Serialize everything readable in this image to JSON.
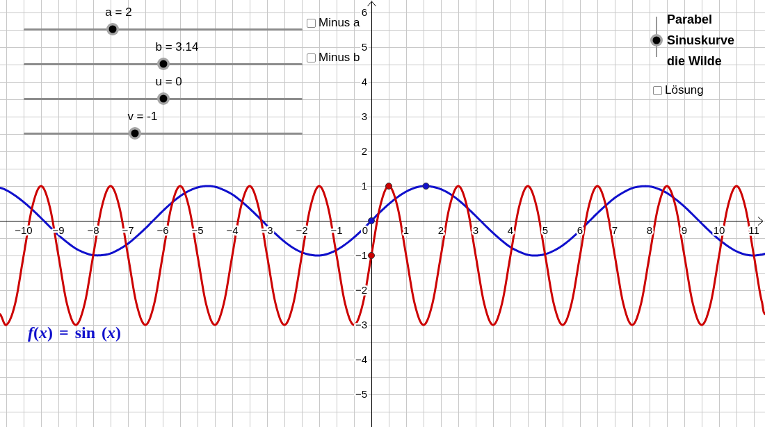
{
  "sliders": [
    {
      "label": "a = 2",
      "level": 0.32
    },
    {
      "label": "b = 3.14",
      "level": 0.5
    },
    {
      "label": "u = 0",
      "level": 0.5
    },
    {
      "label": "v = -1",
      "level": 0.4
    }
  ],
  "checkboxes": [
    {
      "label": "Minus a",
      "checked": false
    },
    {
      "label": "Minus b",
      "checked": false
    }
  ],
  "mode_selector": {
    "options": [
      {
        "label": "Parabel",
        "selected": false
      },
      {
        "label": "Sinuskurve",
        "selected": true
      },
      {
        "label": "die Wilde",
        "selected": false
      }
    ]
  },
  "solution_checkbox": {
    "label": "Lösung",
    "checked": false
  },
  "graph": {
    "function_label": "*f*(*x*) = sin (*x*)",
    "origin_label": "0",
    "chart_data": {
      "type": "line",
      "grid": true,
      "x": [
        -10.68,
        -10.5,
        -10.25,
        -10,
        -9.75,
        -9.5,
        -9.25,
        -9,
        -8.75,
        -8.5,
        -8.25,
        -8,
        -7.75,
        -7.5,
        -7.25,
        -7,
        -6.75,
        -6.5,
        -6.25,
        -6,
        -5.75,
        -5.5,
        -5.25,
        -5,
        -4.75,
        -4.5,
        -4.25,
        -4,
        -3.75,
        -3.5,
        -3.25,
        -3,
        -2.75,
        -2.5,
        -2.25,
        -2,
        -1.75,
        -1.5,
        -1.25,
        -1,
        -0.75,
        -0.5,
        -0.25,
        0,
        0.25,
        0.5,
        0.75,
        1,
        1.25,
        1.5,
        1.75,
        2,
        2.25,
        2.5,
        2.75,
        3,
        3.25,
        3.5,
        3.75,
        4,
        4.25,
        4.5,
        4.75,
        5,
        5.25,
        5.5,
        5.75,
        6,
        6.25,
        6.5,
        6.75,
        7,
        7.25,
        7.5,
        7.75,
        8,
        8.25,
        8.5,
        8.75,
        9,
        9.25,
        9.5,
        9.75,
        10,
        10.25,
        10.5,
        10.75,
        11,
        11.25,
        11.32
      ],
      "series": [
        {
          "color": "#1010cc",
          "values": [
            0.95,
            0.88,
            0.73,
            0.54,
            0.32,
            0.08,
            -0.17,
            -0.41,
            -0.62,
            -0.8,
            -0.92,
            -0.99,
            -0.99,
            -0.94,
            -0.82,
            -0.66,
            -0.45,
            -0.22,
            0.03,
            0.28,
            0.51,
            0.71,
            0.86,
            0.96,
            1,
            0.98,
            0.89,
            0.76,
            0.57,
            0.35,
            0.11,
            -0.14,
            -0.38,
            -0.6,
            -0.78,
            -0.91,
            -0.98,
            -1,
            -0.95,
            -0.84,
            -0.68,
            -0.48,
            -0.25,
            0,
            0.25,
            0.48,
            0.68,
            0.84,
            0.95,
            1,
            0.98,
            0.91,
            0.78,
            0.6,
            0.38,
            0.14,
            -0.11,
            -0.35,
            -0.57,
            -0.76,
            -0.89,
            -0.98,
            -1,
            -0.96,
            -0.86,
            -0.71,
            -0.51,
            -0.28,
            -0.03,
            0.22,
            0.45,
            0.66,
            0.82,
            0.94,
            0.99,
            0.99,
            0.92,
            0.8,
            0.62,
            0.41,
            0.17,
            -0.08,
            -0.32,
            -0.54,
            -0.73,
            -0.88,
            -0.97,
            -1,
            -0.97,
            -0.95
          ]
        },
        {
          "color": "#cc0000",
          "values": [
            -2.69,
            -3,
            -2.41,
            -1,
            0.41,
            1,
            0.41,
            -1,
            -2.41,
            -3,
            -2.41,
            -1,
            0.41,
            1,
            0.41,
            -1,
            -2.41,
            -3,
            -2.41,
            -1,
            0.41,
            1,
            0.41,
            -1,
            -2.41,
            -3,
            -2.41,
            -1,
            0.41,
            1,
            0.41,
            -1,
            -2.41,
            -3,
            -2.41,
            -1,
            0.41,
            1,
            0.41,
            -1,
            -2.41,
            -3,
            -2.41,
            -1,
            0.41,
            1,
            0.41,
            -1,
            -2.41,
            -3,
            -2.41,
            -1,
            0.41,
            1,
            0.41,
            -1,
            -2.41,
            -3,
            -2.41,
            -1,
            0.41,
            1,
            0.41,
            -1,
            -2.41,
            -3,
            -2.41,
            -1,
            0.41,
            1,
            0.41,
            -1,
            -2.41,
            -3,
            -2.41,
            -1,
            0.41,
            1,
            0.41,
            -1,
            -2.41,
            -3,
            -2.41,
            -1,
            0.41,
            1,
            0.41,
            -1,
            -2.41,
            -2.69
          ]
        }
      ],
      "xlim": [
        -10.68,
        11.32
      ],
      "ylim": [
        -5.94,
        6.36
      ],
      "xticks": [
        {
          "value": -10,
          "label": "−10"
        },
        {
          "value": -9,
          "label": "−9"
        },
        {
          "value": -8,
          "label": "−8"
        },
        {
          "value": -7,
          "label": "−7"
        },
        {
          "value": -6,
          "label": "−6"
        },
        {
          "value": -5,
          "label": "−5"
        },
        {
          "value": -4,
          "label": "−4"
        },
        {
          "value": -3,
          "label": "−3"
        },
        {
          "value": -2,
          "label": "−2"
        },
        {
          "value": -1,
          "label": "−1"
        },
        1,
        2,
        3,
        4,
        5,
        6,
        7,
        8,
        9,
        10,
        11
      ],
      "yticks": [
        {
          "value": -5,
          "label": "−5"
        },
        {
          "value": -4,
          "label": "−4"
        },
        {
          "value": -3,
          "label": "−3"
        },
        {
          "value": -2,
          "label": "−2"
        },
        {
          "value": -1,
          "label": "−1"
        },
        1,
        2,
        3,
        4,
        5,
        6
      ]
    },
    "points": {
      "chart_data": {
        "type": "scatter",
        "x": [
          0,
          0.5,
          1.57
        ],
        "series": [
          {
            "color": "#cc0000",
            "values": [
              -1,
              1,
              null
            ]
          },
          {
            "color": "#1010cc",
            "values": [
              0,
              null,
              1
            ]
          }
        ],
        "xlim": [
          -10.68,
          11.32
        ],
        "ylim": [
          -5.94,
          6.36
        ]
      }
    }
  }
}
